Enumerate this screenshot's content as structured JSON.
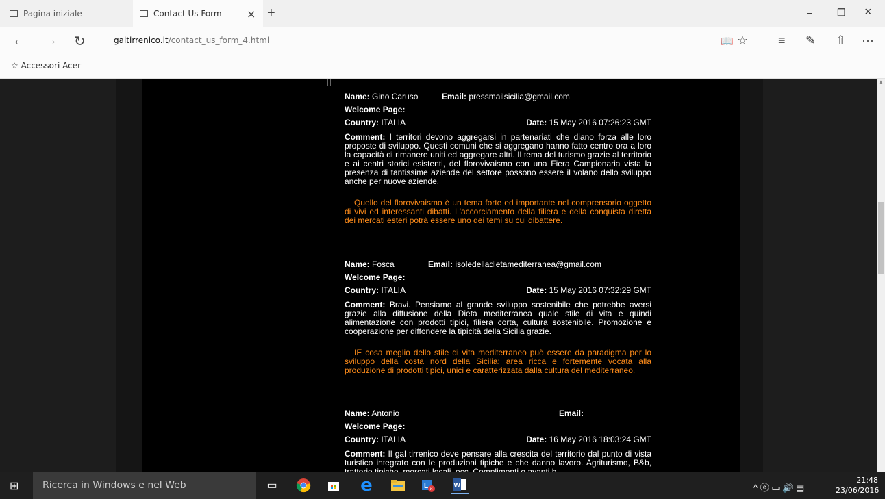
{
  "tabs": [
    {
      "label": "Pagina iniziale"
    },
    {
      "label": "Contact Us Form",
      "close": "×"
    }
  ],
  "new_tab": "+",
  "window_controls": {
    "minimize": "–",
    "restore": "❐",
    "close": "×"
  },
  "nav": {
    "back": "←",
    "forward": "→",
    "refresh": "↻"
  },
  "address": {
    "domain": "galtirrenico.it",
    "path": "/contact_us_form_4.html"
  },
  "toolbar_icons": {
    "reading_view": "📖",
    "favorite": "☆",
    "hub": "≡",
    "note": "✎",
    "share": "⇧",
    "more": "···"
  },
  "favorites": {
    "item": "Accessori Acer",
    "star": "☆"
  },
  "labels": {
    "name": "Name:",
    "email": "Email:",
    "welcome": "Welcome Page:",
    "country": "Country:",
    "date": "Date:",
    "comment": "Comment:"
  },
  "entries": [
    {
      "name": "Gino Caruso",
      "email": "pressmailsicilia@gmail.com",
      "country": "ITALIA",
      "date": "15 May 2016 07:26:23 GMT",
      "comment": "I territori devono aggregarsi in partenariati che diano forza alle loro proposte di sviluppo. Questi comuni che si aggregano hanno fatto centro ora a loro la capacità di rimanere uniti ed aggregare altri. Il tema del turismo grazie al territorio e ai centri storici esistenti, del florovivaismo con una Fiera Campionaria vista la presenza di tantissime aziende del settore possono essere il volano dello sviluppo anche per nuove aziende.",
      "reply": "Quello del florovivaismo è un tema forte ed importante nel comprensorio oggetto di vivi ed interessanti dibatti. L'accorciamento della filiera e della conquista diretta dei mercati esteri potrà essere uno dei temi su cui dibattere."
    },
    {
      "name": "Fosca",
      "email": "isoledelladietamediterranea@gmail.com",
      "country": "ITALIA",
      "date": "15 May 2016 07:32:29 GMT",
      "comment": "Bravi. Pensiamo al grande sviluppo sostenibile che potrebbe aversi grazie alla diffusione della Dieta mediterranea quale stile di vita e quindi alimentazione con prodotti tipici, filiera corta, cultura sostenibile. Promozione e cooperazione per diffondere la tipicità della Sicilia grazie.",
      "reply": "IE cosa meglio dello stile di vita mediterraneo può essere da paradigma per lo sviluppo della costa nord della Sicilia: area ricca e fortemente vocata alla produzione di prodotti tipici, unici e caratterizzata dalla cultura del mediterraneo."
    },
    {
      "name": "Antonio",
      "email": "",
      "country": "ITALIA",
      "date": "16 May 2016 18:03:24 GMT",
      "comment": "Il gal tirrenico deve pensare alla crescita del territorio dal punto di vista turistico integrato con le produzioni tipiche e che danno lavoro. Agriturismo, B&b, trattorie tipiche, mercati locali, ecc. Complimenti e avanti h..."
    }
  ],
  "taskbar": {
    "start": "⊞",
    "search_placeholder": "Ricerca in Windows e nel Web",
    "apps": [
      "task-view",
      "chrome",
      "store",
      "edge",
      "explorer",
      "lync",
      "word"
    ],
    "tray": "^  ⓔ  ▭  🔊  ▤",
    "time": "21:48",
    "date": "23/06/2016"
  }
}
